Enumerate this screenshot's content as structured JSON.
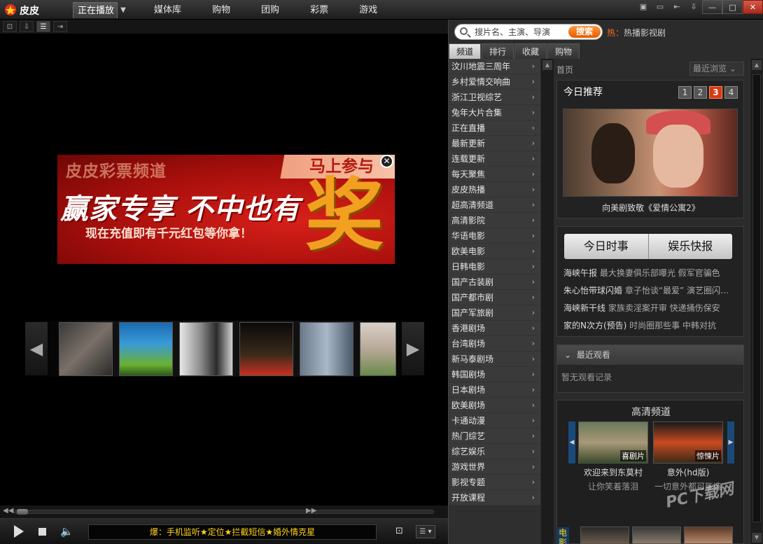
{
  "titlebar": {
    "app_name": "皮皮",
    "nav": [
      {
        "label": "正在播放",
        "active": true
      },
      {
        "label": "媒体库"
      },
      {
        "label": "购物"
      },
      {
        "label": "团购"
      },
      {
        "label": "彩票"
      },
      {
        "label": "游戏"
      }
    ],
    "dropdown_glyph": "▼",
    "controls": {
      "chat": "▣",
      "mini": "▭",
      "prev": "⇤",
      "download": "⇩",
      "minimize": "—",
      "maximize": "□",
      "close": "✕"
    }
  },
  "player": {
    "toolbar": [
      {
        "icon": "capture-icon",
        "glyph": "⊡"
      },
      {
        "icon": "import-icon",
        "glyph": "⇩"
      },
      {
        "icon": "playlist-icon",
        "glyph": "☰"
      },
      {
        "icon": "pin-icon",
        "glyph": "⇥"
      }
    ],
    "ad": {
      "channel": "皮皮彩票频道",
      "join": "马上参与",
      "headline": "赢家专享 不中也有",
      "subline": "现在充值即有千元红包等你拿！",
      "prize": "奖",
      "close": "✕"
    },
    "strip": {
      "prev": "◀",
      "next": "▶"
    },
    "seekbar": {
      "back": "◀◀",
      "forward": "▶▶",
      "position": 0.02
    },
    "ticker": "爆：手机监听★定位★拦截短信★婚外情克星",
    "list_btn": "☰ ▾"
  },
  "right": {
    "search": {
      "placeholder": "搜片名、主演、导演",
      "button": "搜索"
    },
    "hot": {
      "label": "热：",
      "link": "热播影视剧"
    },
    "tabs": [
      {
        "label": "频道",
        "active": true
      },
      {
        "label": "排行"
      },
      {
        "label": "收藏"
      },
      {
        "label": "购物"
      }
    ],
    "categories": [
      "汶川地震三周年",
      "乡村爱情交响曲",
      "浙江卫视综艺",
      "兔年大片合集",
      "正在直播",
      "最新更新",
      "连载更新",
      "每天聚焦",
      "皮皮热播",
      "超高清频道",
      "高清影院",
      "华语电影",
      "欧美电影",
      "日韩电影",
      "国产古装剧",
      "国产都市剧",
      "国产军旅剧",
      "香港剧场",
      "台湾剧场",
      "新马泰剧场",
      "韩国剧场",
      "日本剧场",
      "欧美剧场",
      "卡通动漫",
      "热门综艺",
      "综艺娱乐",
      "游戏世界",
      "影视专题",
      "开放课程"
    ],
    "chevron": "›",
    "scroll_up": "▲",
    "scroll_down": "▼",
    "breadcrumb": "首页",
    "recent_dropdown": "最近浏览 ⌄",
    "recommend": {
      "title": "今日推荐",
      "pages": [
        "1",
        "2",
        "3",
        "4"
      ],
      "active_page": 3,
      "caption": "向美剧致敬《爱情公寓2》"
    },
    "news": {
      "tabs": [
        "今日时事",
        "娱乐快报"
      ],
      "items": [
        {
          "lead": "海峡午报",
          "rest": " 最大换妻俱乐部曝光  假军官骗色"
        },
        {
          "lead": "朱心怡带球闪婚",
          "rest": " 章子怡谈“最爱” 演艺圈闪…"
        },
        {
          "lead": "海峡新干线",
          "rest": " 家族卖淫案开审  快递捅伤保安"
        },
        {
          "lead": "家的N次方(预告)",
          "rest": " 时尚圈那些事  中韩对抗"
        }
      ]
    },
    "recent_watch": {
      "title": "最近观看",
      "empty": "暂无观看记录",
      "collapse": "⌄"
    },
    "hd": {
      "title": "高清频道",
      "prev": "◀",
      "next": "▶",
      "cards": [
        {
          "tag": "喜剧片",
          "name": "欢迎来到东莫村",
          "desc": "让你笑着落泪"
        },
        {
          "tag": "惊悚片",
          "name": "意外(hd版)",
          "desc": "一切意外都可能造"
        }
      ]
    },
    "movie_tag": "电影大",
    "watermark": "PC下载网"
  }
}
